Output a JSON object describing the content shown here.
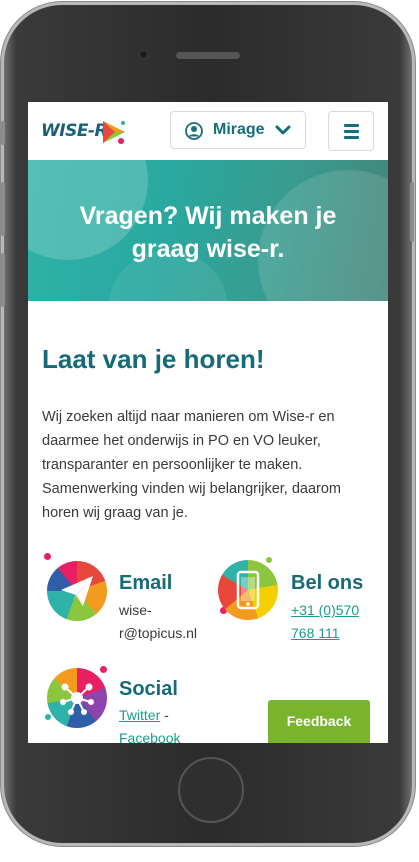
{
  "header": {
    "logo_text": "WISE-R",
    "account_label": "Mirage",
    "user_icon": "user-circle-icon",
    "dropdown_icon": "chevron-down-icon",
    "menu_icon": "hamburger-menu-icon"
  },
  "hero": {
    "title_line1": "Vragen? Wij maken je",
    "title_line2": "graag wise-r."
  },
  "main": {
    "heading": "Laat van je horen!",
    "intro": "Wij zoeken altijd naar manieren om Wise-r en daarmee het onderwijs in PO en VO leuker, transparanter en persoonlijker te maken. Samenwerking vinden wij belangrijker, daarom horen wij graag van je."
  },
  "contact": {
    "email": {
      "title": "Email",
      "line1": "wise-",
      "line2": "r@topicus.nl",
      "icon": "paper-plane-icon"
    },
    "phone": {
      "title": "Bel ons",
      "line1": "+31 (0)570",
      "line2": "768 111",
      "icon": "smartphone-icon"
    },
    "social": {
      "title": "Social",
      "link1": "Twitter",
      "separator": " -",
      "link2": "Facebook",
      "icon": "network-icon"
    }
  },
  "feedback": {
    "label": "Feedback"
  },
  "colors": {
    "brand": "#176a78",
    "accent": "#2fb2a7",
    "feedback": "#7ab32e"
  }
}
